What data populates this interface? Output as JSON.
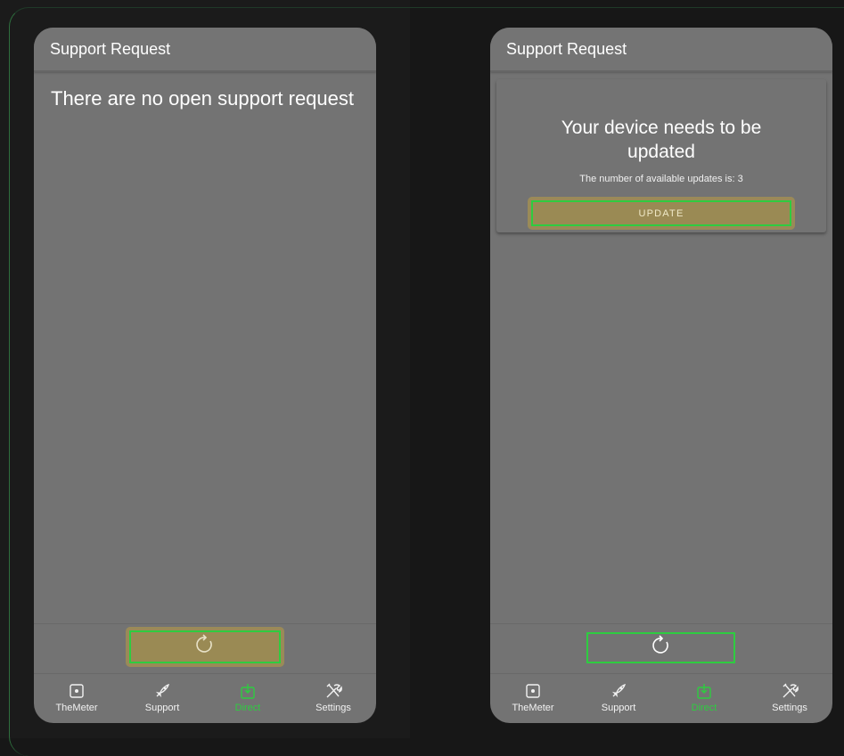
{
  "left": {
    "app_title": "Support Request",
    "empty_message": "There are no open support request",
    "nav": [
      {
        "label": "TheMeter",
        "icon": "meter-icon"
      },
      {
        "label": "Support",
        "icon": "rocket-icon"
      },
      {
        "label": "Direct",
        "icon": "download-icon",
        "active": true
      },
      {
        "label": "Settings",
        "icon": "tools-icon"
      }
    ]
  },
  "right": {
    "app_title": "Support Request",
    "card_title": "Your device needs to be updated",
    "card_subtitle": "The number of available updates is: 3",
    "update_label": "UPDATE",
    "nav": [
      {
        "label": "TheMeter",
        "icon": "meter-icon"
      },
      {
        "label": "Support",
        "icon": "rocket-icon"
      },
      {
        "label": "Direct",
        "icon": "download-icon",
        "active": true
      },
      {
        "label": "Settings",
        "icon": "tools-icon"
      }
    ]
  },
  "colors": {
    "accent": "#2ecc40",
    "highlight": "#9a8a58",
    "surface": "#737373",
    "background": "#171717"
  }
}
